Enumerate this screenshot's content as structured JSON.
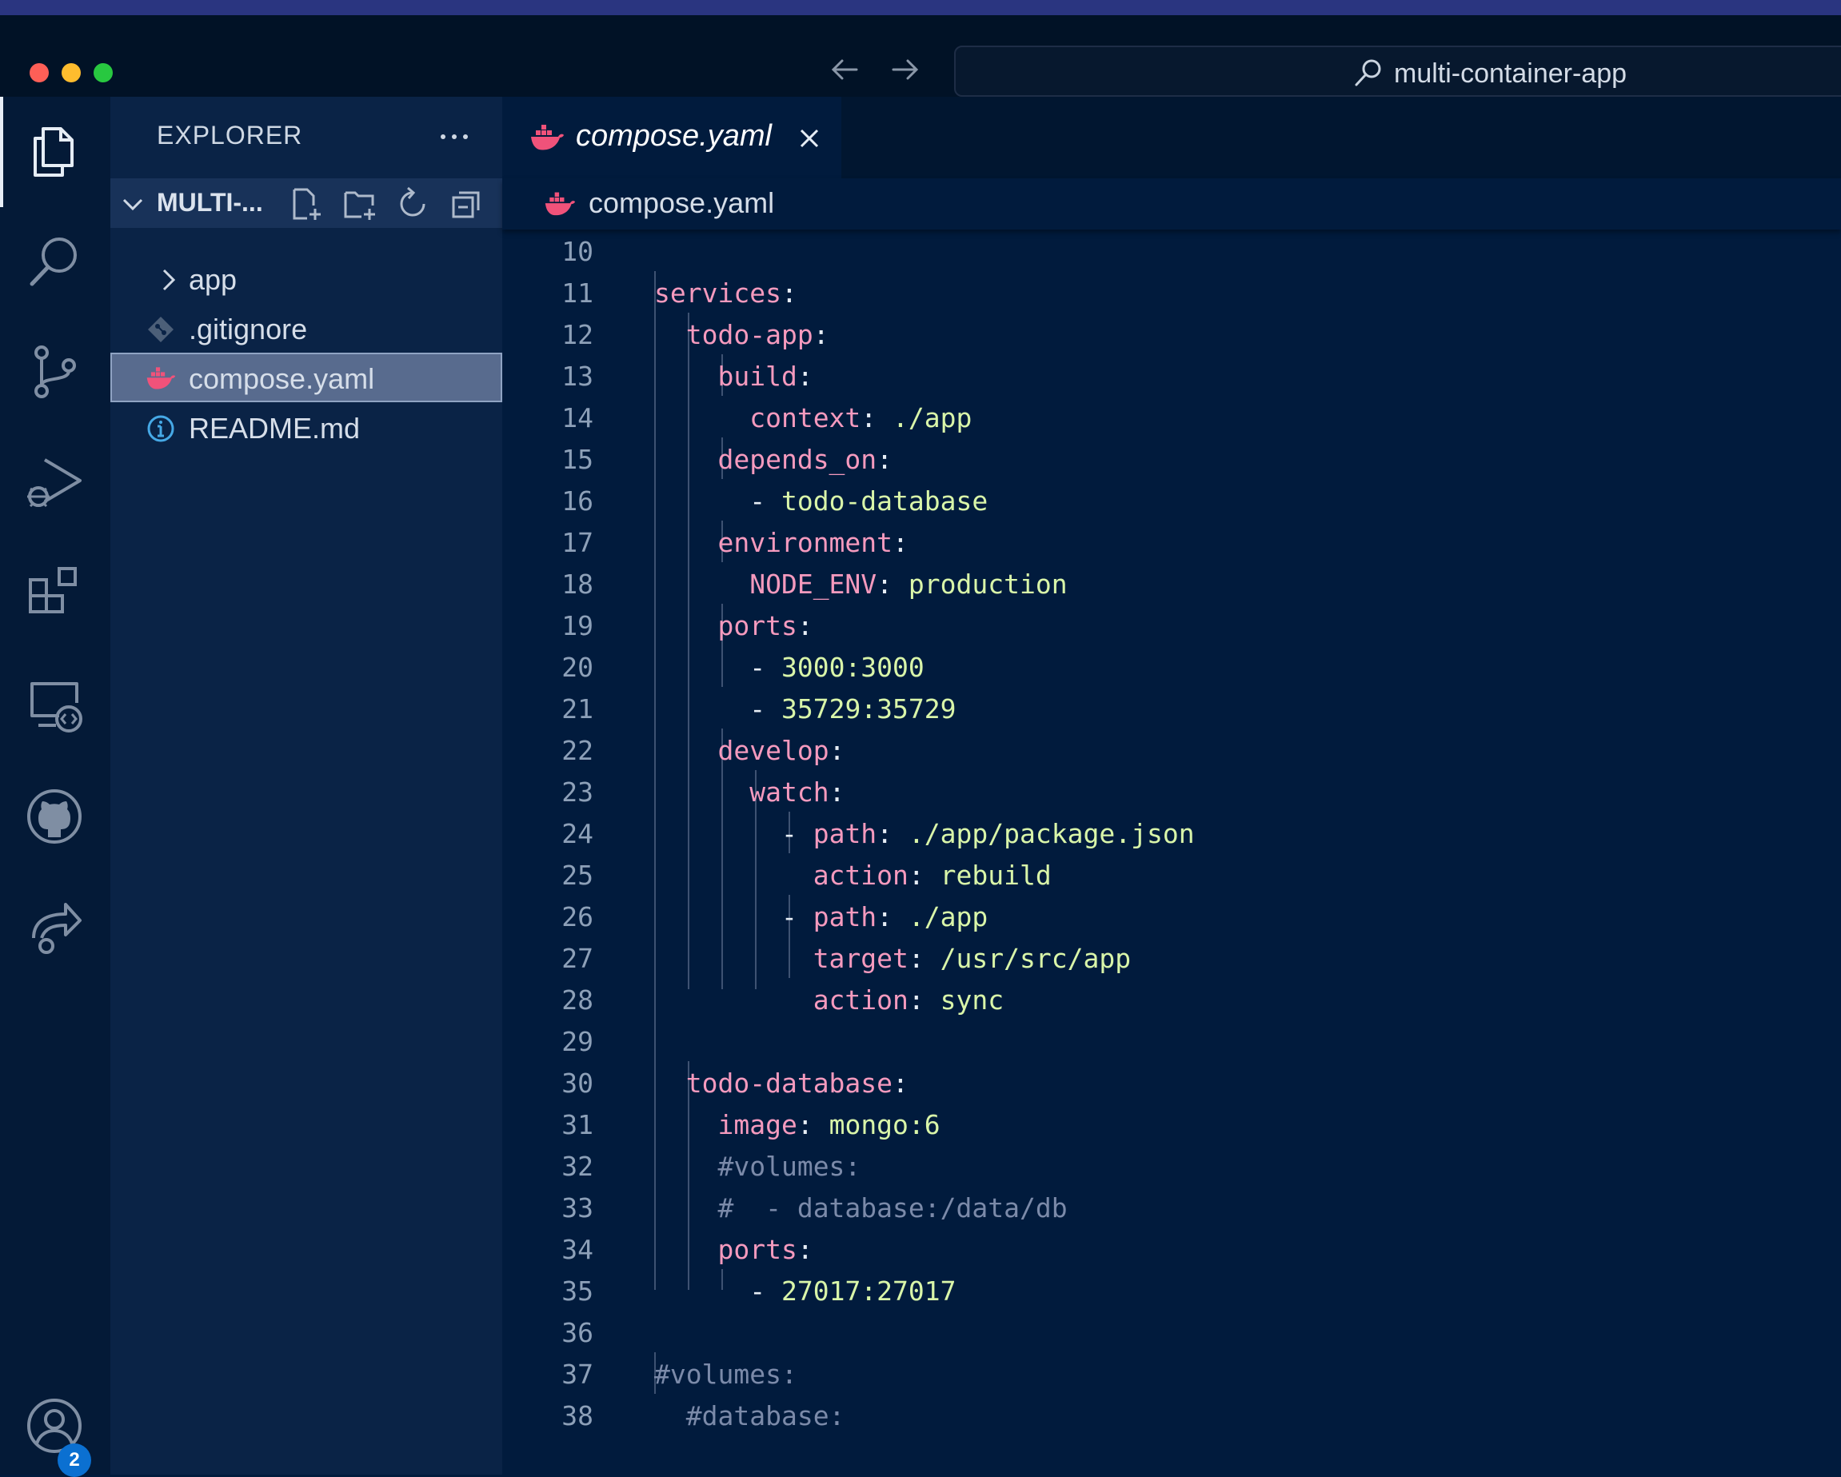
{
  "window": {
    "title": "multi-container-app"
  },
  "activity_bar": {
    "items": [
      "explorer-icon",
      "search-icon",
      "source-control-icon",
      "run-debug-icon",
      "extensions-icon",
      "remote-explorer-icon",
      "github-icon",
      "live-share-icon"
    ],
    "accounts_badge": "2"
  },
  "sidebar": {
    "title": "EXPLORER",
    "folder_name": "MULTI-...",
    "tree": [
      {
        "label": "app",
        "icon": "chevron-right-icon"
      },
      {
        "label": ".gitignore",
        "icon": "git-icon"
      },
      {
        "label": "compose.yaml",
        "icon": "docker-icon",
        "selected": true
      },
      {
        "label": "README.md",
        "icon": "info-icon"
      }
    ]
  },
  "editor": {
    "tab": {
      "label": "compose.yaml"
    },
    "breadcrumb": {
      "file": "compose.yaml"
    },
    "lines": [
      {
        "n": "10",
        "segments": []
      },
      {
        "n": "11",
        "segments": [
          {
            "t": "services",
            "c": "k"
          },
          {
            "t": ":",
            "c": "p"
          }
        ]
      },
      {
        "n": "12",
        "segments": [
          {
            "t": "  "
          },
          {
            "t": "todo-app",
            "c": "k"
          },
          {
            "t": ":",
            "c": "p"
          }
        ]
      },
      {
        "n": "13",
        "segments": [
          {
            "t": "    "
          },
          {
            "t": "build",
            "c": "k"
          },
          {
            "t": ":",
            "c": "p"
          }
        ]
      },
      {
        "n": "14",
        "segments": [
          {
            "t": "      "
          },
          {
            "t": "context",
            "c": "k"
          },
          {
            "t": ": ",
            "c": "p"
          },
          {
            "t": "./app",
            "c": "v"
          }
        ]
      },
      {
        "n": "15",
        "segments": [
          {
            "t": "    "
          },
          {
            "t": "depends_on",
            "c": "k"
          },
          {
            "t": ":",
            "c": "p"
          }
        ]
      },
      {
        "n": "16",
        "segments": [
          {
            "t": "      "
          },
          {
            "t": "- ",
            "c": "p"
          },
          {
            "t": "todo-database",
            "c": "v"
          }
        ]
      },
      {
        "n": "17",
        "segments": [
          {
            "t": "    "
          },
          {
            "t": "environment",
            "c": "k"
          },
          {
            "t": ":",
            "c": "p"
          }
        ]
      },
      {
        "n": "18",
        "segments": [
          {
            "t": "      "
          },
          {
            "t": "NODE_ENV",
            "c": "k"
          },
          {
            "t": ": ",
            "c": "p"
          },
          {
            "t": "production",
            "c": "v"
          }
        ]
      },
      {
        "n": "19",
        "segments": [
          {
            "t": "    "
          },
          {
            "t": "ports",
            "c": "k"
          },
          {
            "t": ":",
            "c": "p"
          }
        ]
      },
      {
        "n": "20",
        "segments": [
          {
            "t": "      "
          },
          {
            "t": "- ",
            "c": "p"
          },
          {
            "t": "3000:3000",
            "c": "v"
          }
        ]
      },
      {
        "n": "21",
        "segments": [
          {
            "t": "      "
          },
          {
            "t": "- ",
            "c": "p"
          },
          {
            "t": "35729:35729",
            "c": "v"
          }
        ]
      },
      {
        "n": "22",
        "segments": [
          {
            "t": "    "
          },
          {
            "t": "develop",
            "c": "k"
          },
          {
            "t": ":",
            "c": "p"
          }
        ]
      },
      {
        "n": "23",
        "segments": [
          {
            "t": "      "
          },
          {
            "t": "watch",
            "c": "k"
          },
          {
            "t": ":",
            "c": "p"
          }
        ]
      },
      {
        "n": "24",
        "segments": [
          {
            "t": "        "
          },
          {
            "t": "- ",
            "c": "p"
          },
          {
            "t": "path",
            "c": "k"
          },
          {
            "t": ": ",
            "c": "p"
          },
          {
            "t": "./app/package.json",
            "c": "v"
          }
        ]
      },
      {
        "n": "25",
        "segments": [
          {
            "t": "          "
          },
          {
            "t": "action",
            "c": "k"
          },
          {
            "t": ": ",
            "c": "p"
          },
          {
            "t": "rebuild",
            "c": "v"
          }
        ]
      },
      {
        "n": "26",
        "segments": [
          {
            "t": "        "
          },
          {
            "t": "- ",
            "c": "p"
          },
          {
            "t": "path",
            "c": "k"
          },
          {
            "t": ": ",
            "c": "p"
          },
          {
            "t": "./app",
            "c": "v"
          }
        ]
      },
      {
        "n": "27",
        "segments": [
          {
            "t": "          "
          },
          {
            "t": "target",
            "c": "k"
          },
          {
            "t": ": ",
            "c": "p"
          },
          {
            "t": "/usr/src/app",
            "c": "v"
          }
        ]
      },
      {
        "n": "28",
        "segments": [
          {
            "t": "          "
          },
          {
            "t": "action",
            "c": "k"
          },
          {
            "t": ": ",
            "c": "p"
          },
          {
            "t": "sync",
            "c": "v"
          }
        ]
      },
      {
        "n": "29",
        "segments": []
      },
      {
        "n": "30",
        "segments": [
          {
            "t": "  "
          },
          {
            "t": "todo-database",
            "c": "k"
          },
          {
            "t": ":",
            "c": "p"
          }
        ]
      },
      {
        "n": "31",
        "segments": [
          {
            "t": "    "
          },
          {
            "t": "image",
            "c": "k"
          },
          {
            "t": ": ",
            "c": "p"
          },
          {
            "t": "mongo:6",
            "c": "v"
          }
        ]
      },
      {
        "n": "32",
        "segments": [
          {
            "t": "    "
          },
          {
            "t": "#volumes:",
            "c": "c"
          }
        ]
      },
      {
        "n": "33",
        "segments": [
          {
            "t": "    "
          },
          {
            "t": "#  - database:/data/db",
            "c": "c"
          }
        ]
      },
      {
        "n": "34",
        "segments": [
          {
            "t": "    "
          },
          {
            "t": "ports",
            "c": "k"
          },
          {
            "t": ":",
            "c": "p"
          }
        ]
      },
      {
        "n": "35",
        "segments": [
          {
            "t": "      "
          },
          {
            "t": "- ",
            "c": "p"
          },
          {
            "t": "27017:27017",
            "c": "v"
          }
        ]
      },
      {
        "n": "36",
        "segments": []
      },
      {
        "n": "37",
        "segments": [
          {
            "t": "#volumes:",
            "c": "c"
          }
        ]
      },
      {
        "n": "38",
        "segments": [
          {
            "t": "  "
          },
          {
            "t": "#database:",
            "c": "c"
          }
        ]
      }
    ]
  },
  "colors": {
    "key": "#f59abe",
    "value": "#d9f5a9",
    "comment": "#7b8aa9",
    "docker_icon": "#f0527a",
    "badge": "#0b70d1"
  }
}
